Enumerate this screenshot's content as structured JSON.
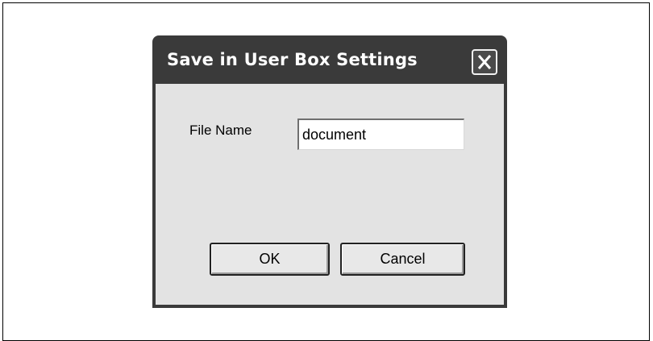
{
  "dialog": {
    "title": "Save in User Box Settings",
    "close_icon": "close-icon"
  },
  "form": {
    "file_name_label": "File Name",
    "file_name_value": "document"
  },
  "buttons": {
    "ok_label": "OK",
    "cancel_label": "Cancel"
  }
}
